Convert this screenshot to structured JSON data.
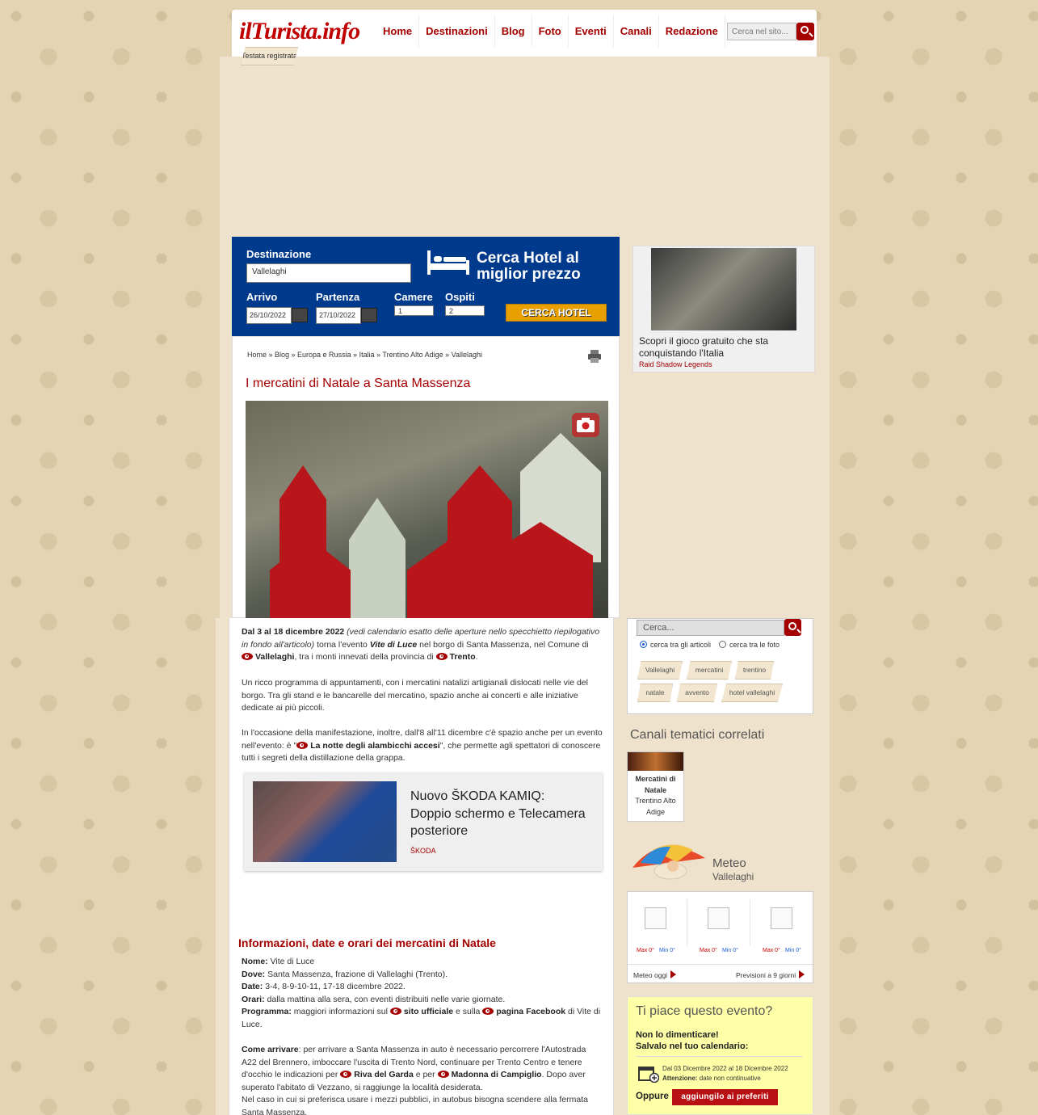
{
  "site": {
    "logo": "ilTurista.info",
    "tagline": "Testata registrata"
  },
  "nav": {
    "items": [
      "Home",
      "Destinazioni",
      "Blog",
      "Foto",
      "Eventi",
      "Canali",
      "Redazione"
    ],
    "search_placeholder": "Cerca nel sito..."
  },
  "hotel": {
    "destination_label": "Destinazione",
    "destination_value": "Vallelaghi",
    "headline": "Cerca Hotel al miglior prezzo",
    "arrival_label": "Arrivo",
    "arrival_value": "26/10/2022",
    "departure_label": "Partenza",
    "departure_value": "27/10/2022",
    "rooms_label": "Camere",
    "rooms_value": "1",
    "guests_label": "Ospiti",
    "guests_value": "2",
    "button": "CERCA HOTEL"
  },
  "breadcrumb": "Home » Blog » Europa e Russia » Italia » Trentino Alto Adige » Vallelaghi",
  "article": {
    "title": "I mercatini di Natale a Santa Massenza",
    "p1_date": "Dal 3 al 18 dicembre 2022",
    "p1_note": "(vedi calendario esatto delle aperture nello specchietto riepilogativo in fondo all'articolo)",
    "p1_a": "torna l'evento",
    "p1_event": "Vite di Luce",
    "p1_b": "nel borgo di Santa Massenza, nel Comune di",
    "p1_link1": "Vallelaghi",
    "p1_c": ", tra i monti innevati della provincia di",
    "p1_link2": "Trento",
    "p1_d": ".",
    "p2": "Un ricco programma di appuntamenti, con i mercatini natalizi artigianali dislocati nelle vie del borgo. Tra gli stand e le bancarelle del mercatino, spazio anche ai concerti e alle iniziative dedicate ai più piccoli.",
    "p3_a": "In l'occasione della manifestazione, inoltre, dall'8 all'11 dicembre c'è spazio anche per un evento nell'evento: è \"",
    "p3_link": "La notte degli alambicchi accesi",
    "p3_b": "\", che permette agli spettatori di conoscere tutti i segreti della distillazione della grappa.",
    "info_title": "Informazioni, date e orari dei mercatini di Natale",
    "nome_label": "Nome:",
    "nome": "Vite di Luce",
    "dove_label": "Dove:",
    "dove": "Santa Massenza, frazione di Vallelaghi (Trento).",
    "date_label": "Date:",
    "date": "3-4, 8-9-10-11, 17-18 dicembre 2022.",
    "orari_label": "Orari:",
    "orari": "dalla mattina alla sera, con eventi distribuiti nelle varie giornate.",
    "programma_label": "Programma:",
    "programma_a": "maggiori informazioni sul",
    "programma_link1": "sito ufficiale",
    "programma_b": "e sulla",
    "programma_link2": "pagina Facebook",
    "programma_c": "di Vite di Luce.",
    "arrivare_label": "Come arrivare",
    "arrivare_a": ": per arrivare a Santa Massenza in auto è necessario percorrere l'Autostrada A22 del Brennero, imboccare l'uscita di Trento Nord, continuare per Trento Centro e tenere d'occhio le indicazioni per",
    "arrivare_link1": "Riva del Garda",
    "arrivare_b": "e per",
    "arrivare_link2": "Madonna di Campiglio",
    "arrivare_c": ". Dopo aver superato l'abitato di Vezzano, si raggiunge la località desiderata.",
    "arrivare_d": "Nel caso in cui si preferisca usare i mezzi pubblici, in autobus bisogna scendere alla fermata Santa Massenza."
  },
  "ad_right": {
    "text": "Scopri il gioco gratuito che sta conquistando l'Italia",
    "source": "Raid Shadow Legends"
  },
  "ad_card": {
    "title": "Nuovo ŠKODA KAMIQ: Doppio schermo e Telecamera posteriore",
    "brand": "ŠKODA"
  },
  "sidebar_search": {
    "placeholder": "Cerca...",
    "radio_articles": "cerca tra gli articoli",
    "radio_photos": "cerca tra le foto",
    "tags": [
      "Vallelaghi",
      "mercatini",
      "trentino",
      "natale",
      "avvento",
      "hotel vallelaghi"
    ]
  },
  "canali": {
    "title": "Canali tematici correlati",
    "card_title": "Mercatini di Natale",
    "card_sub": "Trentino Alto Adige"
  },
  "meteo": {
    "title": "Meteo",
    "place": "Vallelaghi",
    "days": [
      {
        "max": "Max 0°",
        "min": "Min 0°"
      },
      {
        "max": "Max 0°",
        "min": "Min 0°"
      },
      {
        "max": "Max 0°",
        "min": "Min 0°"
      }
    ],
    "link_today": "Meteo oggi",
    "link_forecast": "Previsioni a 9 giorni"
  },
  "evento": {
    "title": "Ti piace questo evento?",
    "remind1": "Non lo dimenticare!",
    "remind2": "Salvalo nel tuo calendario:",
    "dates": "Dal 03 Dicembre 2022 al 18 Dicembre 2022",
    "attention_label": "Attenzione:",
    "attention": "date non continuative",
    "oppure": "Oppure",
    "button": "aggiungilo ai preferiti"
  },
  "colors": {
    "brand_red": "#a40000",
    "hotel_blue": "#003a8c",
    "hotel_button": "#e8a000",
    "panel_beige": "#efe2cc",
    "event_yellow": "#ffffa8"
  }
}
